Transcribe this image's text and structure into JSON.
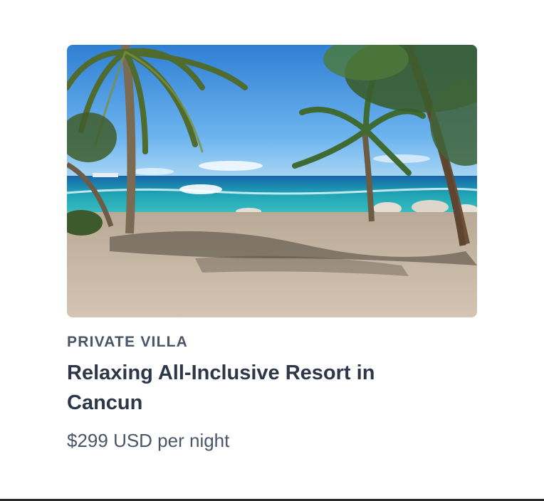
{
  "card": {
    "category": "PRIVATE VILLA",
    "title": "Relaxing All-Inclusive Resort in Cancun",
    "price": "$299 USD per night",
    "image": {
      "sky_color": "#5aa7e8",
      "sea_color": "#1fa3b4",
      "sand_color": "#c9b9a6"
    }
  }
}
